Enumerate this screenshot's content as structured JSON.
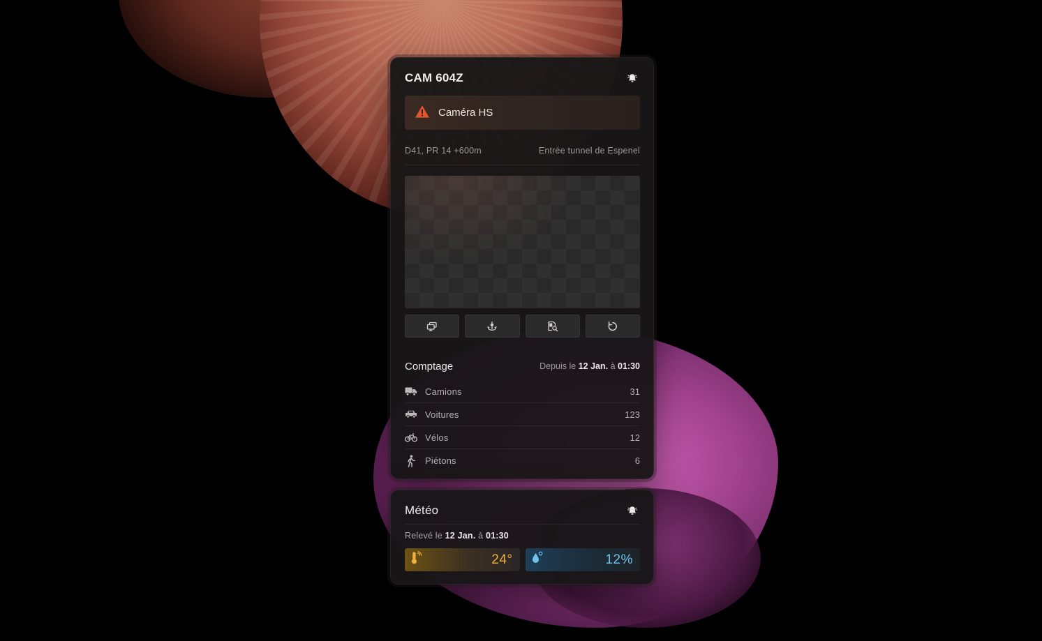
{
  "camera": {
    "title": "CAM 604Z",
    "alarm_icon": "alarm-bell-icon",
    "alert": {
      "icon": "warning-triangle-icon",
      "color": "#e4572e",
      "text": "Caméra HS"
    },
    "location": {
      "road": "D41, PR 14 +600m",
      "place": "Entrée tunnel de Espenel"
    },
    "video_placeholder": "empty-feed",
    "controls": [
      {
        "name": "screen-icon"
      },
      {
        "name": "pan-tilt-icon"
      },
      {
        "name": "search-record-icon"
      },
      {
        "name": "refresh-icon"
      }
    ]
  },
  "counting": {
    "title": "Comptage",
    "since_prefix": "Depuis le",
    "since_date": "12 Jan.",
    "since_at": "à",
    "since_time": "01:30",
    "items": [
      {
        "icon": "truck-icon",
        "label": "Camions",
        "value": "31"
      },
      {
        "icon": "car-icon",
        "label": "Voitures",
        "value": "123"
      },
      {
        "icon": "bicycle-icon",
        "label": "Vélos",
        "value": "12"
      },
      {
        "icon": "pedestrian-icon",
        "label": "Piétons",
        "value": "6"
      }
    ]
  },
  "weather": {
    "title": "Météo",
    "alarm_icon": "alarm-bell-icon",
    "releve_prefix": "Relevé le",
    "releve_date": "12 Jan.",
    "releve_at": "à",
    "releve_time": "01:30",
    "temperature": {
      "icon": "thermometer-icon",
      "value": "24°",
      "color": "#f0b13c"
    },
    "humidity": {
      "icon": "water-drop-icon",
      "value": "12%",
      "color": "#6fc3ea"
    }
  }
}
